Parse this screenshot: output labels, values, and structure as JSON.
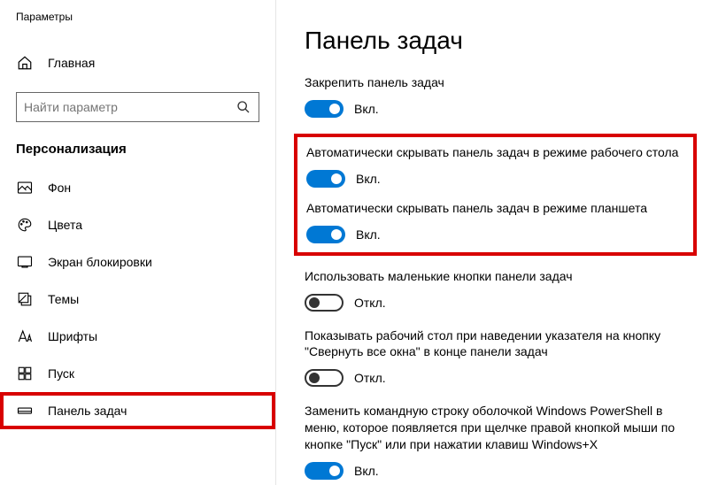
{
  "app_title": "Параметры",
  "home_label": "Главная",
  "search_placeholder": "Найти параметр",
  "section_title": "Персонализация",
  "nav": [
    {
      "label": "Фон",
      "icon": "image-icon"
    },
    {
      "label": "Цвета",
      "icon": "palette-icon"
    },
    {
      "label": "Экран блокировки",
      "icon": "lock-screen-icon"
    },
    {
      "label": "Темы",
      "icon": "themes-icon"
    },
    {
      "label": "Шрифты",
      "icon": "fonts-icon"
    },
    {
      "label": "Пуск",
      "icon": "start-icon"
    },
    {
      "label": "Панель задач",
      "icon": "taskbar-icon"
    }
  ],
  "page_heading": "Панель задач",
  "settings": {
    "lock_taskbar": {
      "desc": "Закрепить панель задач",
      "state": "Вкл.",
      "on": true
    },
    "autohide_desktop": {
      "desc": "Автоматически скрывать панель задач в режиме рабочего стола",
      "state": "Вкл.",
      "on": true
    },
    "autohide_tablet": {
      "desc": "Автоматически скрывать панель задач в режиме планшета",
      "state": "Вкл.",
      "on": true
    },
    "small_buttons": {
      "desc": "Использовать маленькие кнопки панели задач",
      "state": "Откл.",
      "on": false
    },
    "peek_desktop": {
      "desc": "Показывать рабочий стол при наведении указателя на кнопку \"Свернуть все окна\" в конце панели задач",
      "state": "Откл.",
      "on": false
    },
    "powershell": {
      "desc": "Заменить командную строку оболочкой Windows PowerShell в меню, которое появляется при щелчке правой кнопкой мыши по кнопке \"Пуск\" или при нажатии клавиш Windows+X",
      "state": "Вкл.",
      "on": true
    }
  }
}
